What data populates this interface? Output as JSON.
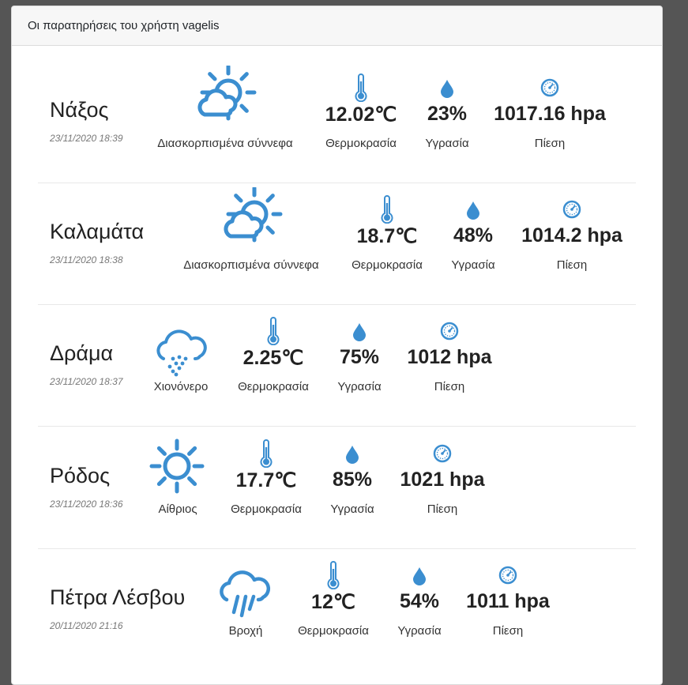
{
  "header": {
    "title": "Οι παρατηρήσεις του χρήστη vagelis"
  },
  "labels": {
    "temperature": "Θερμοκρασία",
    "humidity": "Υγρασία",
    "pressure": "Πίεση"
  },
  "observations": [
    {
      "city": "Νάξος",
      "date": "23/11/2020 18:39",
      "condition": "Διασκορπισμένα σύννεφα",
      "condition_icon": "partly-cloudy-icon",
      "temperature": "12.02℃",
      "humidity": "23%",
      "pressure": "1017.16 hpa"
    },
    {
      "city": "Καλαμάτα",
      "date": "23/11/2020 18:38",
      "condition": "Διασκορπισμένα σύννεφα",
      "condition_icon": "partly-cloudy-icon",
      "temperature": "18.7℃",
      "humidity": "48%",
      "pressure": "1014.2 hpa"
    },
    {
      "city": "Δράμα",
      "date": "23/11/2020 18:37",
      "condition": "Χιονόνερο",
      "condition_icon": "sleet-icon",
      "temperature": "2.25℃",
      "humidity": "75%",
      "pressure": "1012 hpa"
    },
    {
      "city": "Ρόδος",
      "date": "23/11/2020 18:36",
      "condition": "Αίθριος",
      "condition_icon": "sun-icon",
      "temperature": "17.7℃",
      "humidity": "85%",
      "pressure": "1021 hpa"
    },
    {
      "city": "Πέτρα Λέσβου",
      "date": "20/11/2020 21:16",
      "condition": "Βροχή",
      "condition_icon": "rain-icon",
      "temperature": "12℃",
      "humidity": "54%",
      "pressure": "1011 hpa"
    }
  ],
  "colors": {
    "accent": "#3b8ed0",
    "background": "#555555"
  }
}
